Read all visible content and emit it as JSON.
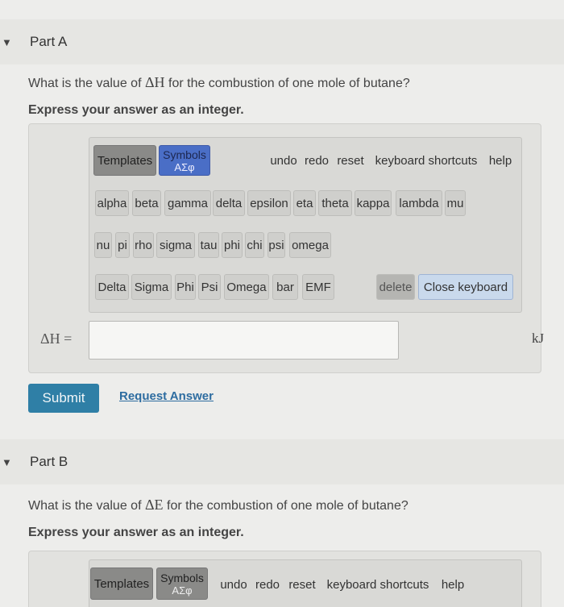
{
  "partA": {
    "title": "Part A",
    "question_prefix": "What is the value of",
    "question_math": "ΔH",
    "question_suffix": "for the combustion of one mole of butane?",
    "instruction": "Express your answer as an integer.",
    "toolbar": {
      "templates": "Templates",
      "symbols": "Symbols",
      "symbols_sub": "ΑΣφ",
      "undo": "undo",
      "redo": "redo",
      "reset": "reset",
      "shortcuts": "keyboard shortcuts",
      "help": "help"
    },
    "greek_row1": [
      "alpha",
      "beta",
      "gamma",
      "delta",
      "epsilon",
      "eta",
      "theta",
      "kappa",
      "lambda",
      "mu"
    ],
    "greek_row2": [
      "nu",
      "pi",
      "rho",
      "sigma",
      "tau",
      "phi",
      "chi",
      "psi",
      "omega"
    ],
    "greek_row3": [
      "Delta",
      "Sigma",
      "Phi",
      "Psi",
      "Omega",
      "bar",
      "EMF"
    ],
    "delete": "delete",
    "close_keyboard": "Close keyboard",
    "input_label": "ΔH =",
    "input_value": "",
    "unit": "kJ",
    "submit": "Submit",
    "request": "Request Answer"
  },
  "partB": {
    "title": "Part B",
    "question_prefix": "What is the value of",
    "question_math": "ΔE",
    "question_suffix": "for the combustion of one mole of butane?",
    "instruction": "Express your answer as an integer.",
    "toolbar": {
      "templates": "Templates",
      "symbols": "Symbols",
      "symbols_sub": "ΑΣφ",
      "undo": "undo",
      "redo": "redo",
      "reset": "reset",
      "shortcuts": "keyboard shortcuts",
      "help": "help"
    }
  },
  "icons": {
    "collapse": "▼"
  },
  "colors": {
    "submit": "#2f7fa6",
    "symbols_active": "#4a6ec6",
    "link": "#2d6ca0"
  }
}
